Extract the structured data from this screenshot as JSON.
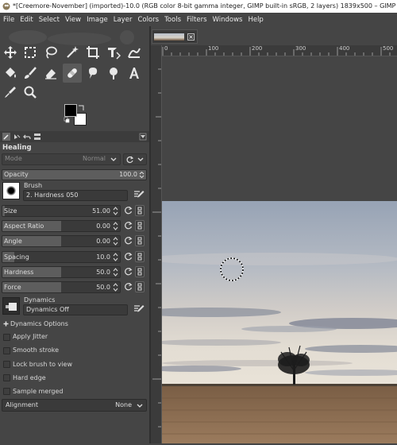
{
  "window": {
    "title": "*[Creemore-November] (imported)-10.0 (RGB color 8-bit gamma integer, GIMP built-in sRGB, 2 layers) 1839x500 – GIMP"
  },
  "menu": [
    "File",
    "Edit",
    "Select",
    "View",
    "Image",
    "Layer",
    "Colors",
    "Tools",
    "Filters",
    "Windows",
    "Help"
  ],
  "toolbox": {
    "tools": [
      "move-tool",
      "rect-select-tool",
      "lasso-tool",
      "fuzzy-select-tool",
      "crop-tool",
      "unified-transform-tool",
      "warp-tool",
      "bucket-fill-tool",
      "paintbrush-tool",
      "eraser-tool",
      "heal-tool",
      "smudge-tool",
      "dodge-tool",
      "text-tool",
      "color-picker-tool",
      "zoom-tool"
    ],
    "active_tool": "heal-tool",
    "fg_color": "#000000",
    "bg_color": "#ffffff"
  },
  "tool_options": {
    "tool_name": "Healing",
    "mode_label": "Mode",
    "mode_value": "Normal",
    "opacity_label": "Opacity",
    "opacity_value": "100.0",
    "brush_label": "Brush",
    "brush_name": "2. Hardness 050",
    "sliders": [
      {
        "label": "Size",
        "value": "51.00",
        "fill": 0.02
      },
      {
        "label": "Aspect Ratio",
        "value": "0.00",
        "fill": 0.5
      },
      {
        "label": "Angle",
        "value": "0.00",
        "fill": 0.5
      },
      {
        "label": "Spacing",
        "value": "10.0",
        "fill": 0.1
      },
      {
        "label": "Hardness",
        "value": "50.0",
        "fill": 0.5
      },
      {
        "label": "Force",
        "value": "50.0",
        "fill": 0.5
      }
    ],
    "dynamics_label": "Dynamics",
    "dynamics_value": "Dynamics Off",
    "dynamics_options_label": "Dynamics Options",
    "checkboxes": [
      "Apply Jitter",
      "Smooth stroke",
      "Lock brush to view",
      "Hard edge",
      "Sample merged"
    ],
    "alignment_label": "Alignment",
    "alignment_value": "None"
  },
  "ruler": {
    "ticks": [
      "0",
      "100",
      "200",
      "300",
      "400",
      "500"
    ]
  }
}
